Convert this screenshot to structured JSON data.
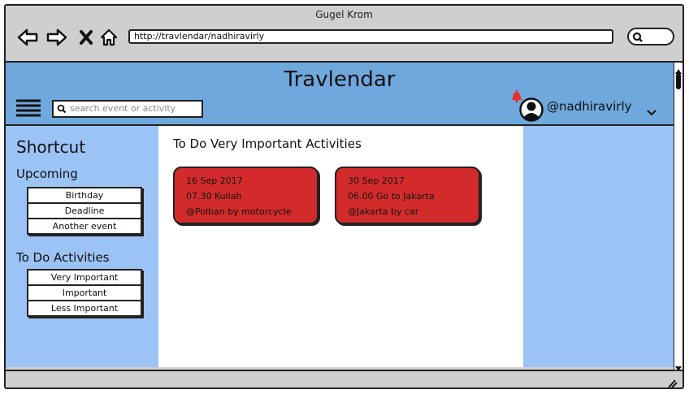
{
  "browser": {
    "title": "Gugel Krom",
    "url": "http://travlendar/nadhiravirly"
  },
  "app": {
    "title": "Travlendar",
    "search_placeholder": "search event or activity",
    "username": "@nadhiravirly",
    "colors": {
      "header": "#6ea8dc",
      "sidebar": "#9cc3f5",
      "card": "#d32b2b"
    }
  },
  "sidebar": {
    "title": "Shortcut",
    "upcoming": {
      "label": "Upcoming",
      "items": [
        "Birthday",
        "Deadline",
        "Another event"
      ]
    },
    "todo": {
      "label": "To Do Activities",
      "items": [
        "Very Important",
        "Important",
        "Less Important"
      ]
    }
  },
  "main": {
    "title": "To Do Very Important Activities",
    "cards": [
      {
        "date": "16 Sep 2017",
        "activity": "07.30 Kuliah",
        "location": "@Polban by motorcycle"
      },
      {
        "date": "30 Sep 2017",
        "activity": "06.00 Go to Jakarta",
        "location": "@Jakarta by car"
      }
    ]
  }
}
